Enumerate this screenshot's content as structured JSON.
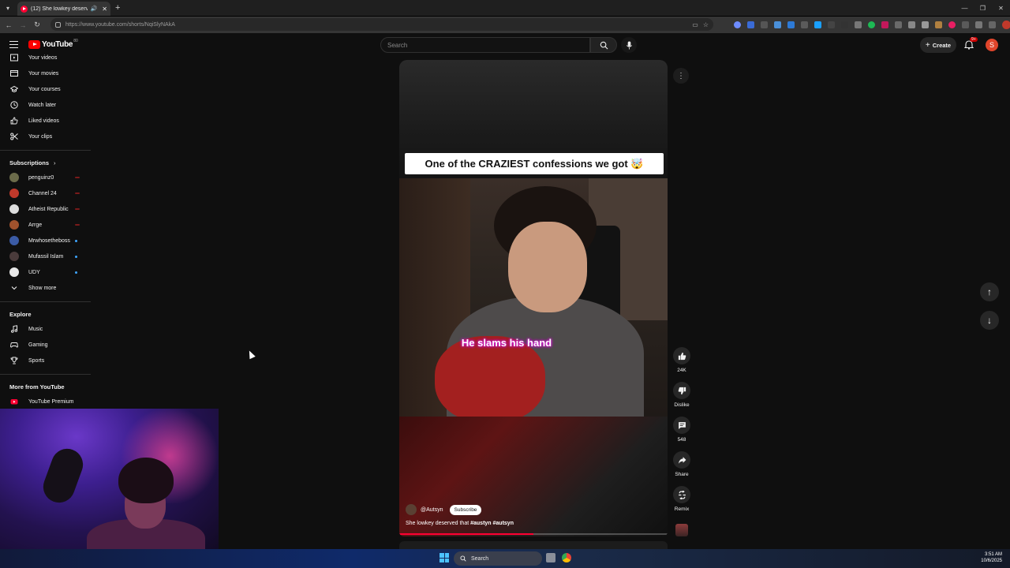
{
  "browser": {
    "tab_title": "(12) She lowkey deserved th",
    "url": "https://www.youtube.com/shorts/NqiSlyNAkA",
    "new_tab_symbol": "+"
  },
  "masthead": {
    "logo_text": "YouTube",
    "logo_superscript": "80",
    "search_placeholder": "Search",
    "create_label": "Create",
    "notifications_badge": "9+",
    "avatar_letter": "S"
  },
  "sidebar": {
    "you_items": [
      {
        "label": "Your videos",
        "icon": "play-square-icon"
      },
      {
        "label": "Your movies",
        "icon": "film-icon"
      },
      {
        "label": "Your courses",
        "icon": "graduation-cap-icon"
      },
      {
        "label": "Watch later",
        "icon": "clock-icon"
      },
      {
        "label": "Liked videos",
        "icon": "thumbs-up-icon"
      },
      {
        "label": "Your clips",
        "icon": "scissors-icon"
      }
    ],
    "subscriptions_heading": "Subscriptions",
    "subscriptions": [
      {
        "label": "penguinz0",
        "color": "#6b6b4a",
        "dot": "#7a1a1a"
      },
      {
        "label": "Channel 24",
        "color": "#c0392b",
        "dot": "#7a1a1a"
      },
      {
        "label": "Atheist Republic",
        "color": "#dddddd",
        "dot": "#7a1a1a"
      },
      {
        "label": "Arrge",
        "color": "#a0522d",
        "dot": "#7a1a1a"
      },
      {
        "label": "Mrwhosetheboss",
        "color": "#3b5ba5",
        "dot": "#3ea6ff"
      },
      {
        "label": "Mufassil Islam",
        "color": "#4a3b3b",
        "dot": "#3ea6ff"
      },
      {
        "label": "UDY",
        "color": "#e8e8e8",
        "dot": "#3ea6ff"
      }
    ],
    "show_more": "Show more",
    "explore_heading": "Explore",
    "explore_items": [
      {
        "label": "Music",
        "icon": "music-note-icon"
      },
      {
        "label": "Gaming",
        "icon": "gamepad-icon"
      },
      {
        "label": "Sports",
        "icon": "trophy-icon"
      }
    ],
    "more_heading": "More from YouTube",
    "more_items": [
      {
        "label": "YouTube Premium",
        "icon": "youtube-premium-icon"
      }
    ]
  },
  "short": {
    "caption": "One of the CRAZIEST confessions we got 🤯",
    "subtitle": "He slams his hand",
    "channel": "@Autsyn",
    "subscribe_label": "Subscribe",
    "description_prefix": "She lowkey deserved that ",
    "description_tags": "#austyn #autsyn",
    "progress": 0.5
  },
  "actions": {
    "likes": "24K",
    "dislike": "Dislike",
    "comments": "548",
    "share": "Share",
    "remix": "Remix"
  },
  "taskbar": {
    "search_label": "Search",
    "time": "3:51 AM",
    "date": "10/6/2025"
  }
}
